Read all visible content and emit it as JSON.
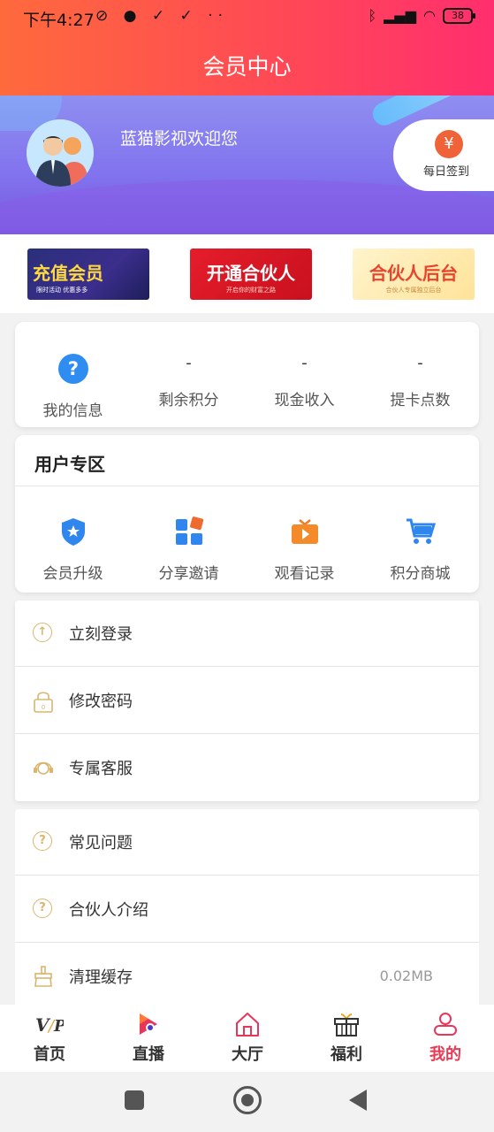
{
  "status_bar": {
    "time": "下午4:27",
    "battery": "38"
  },
  "header": {
    "title": "会员中心"
  },
  "profile": {
    "welcome": "蓝猫影视欢迎您",
    "signin_label": "每日签到",
    "signin_icon": "yen-icon"
  },
  "promos": [
    {
      "title": "充值会员",
      "subtitle": "限时活动 优惠多多"
    },
    {
      "title": "开通合伙人",
      "subtitle": "开启你的财富之路"
    },
    {
      "title": "合伙人后台",
      "subtitle": "合伙人专属独立后台"
    }
  ],
  "stats": [
    {
      "label": "我的信息",
      "icon": "question-icon"
    },
    {
      "value": "-",
      "label": "剩余积分"
    },
    {
      "value": "-",
      "label": "现金收入"
    },
    {
      "value": "-",
      "label": "提卡点数"
    }
  ],
  "user_zone": {
    "title": "用户专区",
    "items": [
      {
        "label": "会员升级",
        "icon": "shield-star-icon"
      },
      {
        "label": "分享邀请",
        "icon": "grid-share-icon"
      },
      {
        "label": "观看记录",
        "icon": "tv-play-icon"
      },
      {
        "label": "积分商城",
        "icon": "cart-icon"
      }
    ]
  },
  "menu_group1": [
    {
      "label": "立刻登录",
      "icon": "login-icon"
    },
    {
      "label": "修改密码",
      "icon": "lock-icon"
    },
    {
      "label": "专属客服",
      "icon": "headset-icon"
    }
  ],
  "menu_group2": [
    {
      "label": "常见问题",
      "icon": "question-circle-icon"
    },
    {
      "label": "合伙人介绍",
      "icon": "question-circle-icon"
    },
    {
      "label": "清理缓存",
      "icon": "broom-icon",
      "value": "0.02MB"
    }
  ],
  "tabbar": [
    {
      "label": "首页",
      "icon": "vip-icon"
    },
    {
      "label": "直播",
      "icon": "live-play-icon"
    },
    {
      "label": "大厅",
      "icon": "home-icon"
    },
    {
      "label": "福利",
      "icon": "gift-icon"
    },
    {
      "label": "我的",
      "icon": "user-icon",
      "active": true
    }
  ],
  "colors": {
    "accent": "#e83b55",
    "header_start": "#ff6a3d",
    "header_end": "#ff2e6e",
    "gold": "#d9b56e"
  }
}
